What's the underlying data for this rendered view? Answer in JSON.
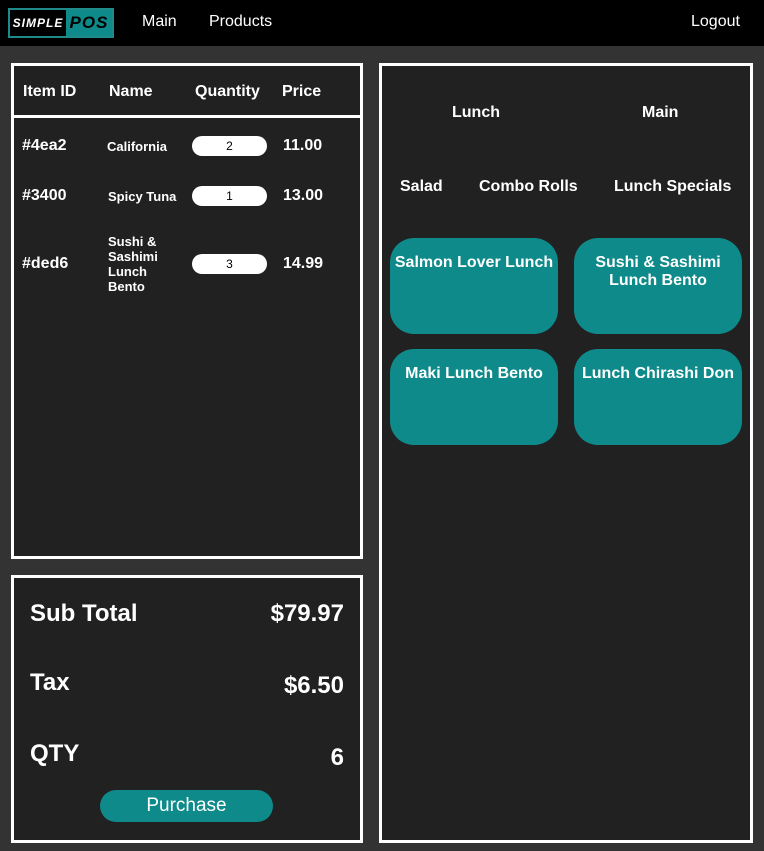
{
  "nav": {
    "logo_left": "SIMPLE",
    "logo_right": "POS",
    "main": "Main",
    "products": "Products",
    "logout": "Logout"
  },
  "cart": {
    "headers": [
      "Item ID",
      "Name",
      "Quantity",
      "Price"
    ],
    "rows": [
      {
        "id": "#4ea2",
        "name": "California",
        "qty": "2",
        "price": "11.00"
      },
      {
        "id": "#3400",
        "name": "Spicy Tuna",
        "qty": "1",
        "price": "13.00"
      },
      {
        "id": "#ded6",
        "name": "Sushi & Sashimi Lunch Bento",
        "qty": "3",
        "price": "14.99"
      }
    ]
  },
  "totals": {
    "subtotal_label": "Sub Total",
    "subtotal_value": "$79.97",
    "tax_label": "Tax",
    "tax_value": "$6.50",
    "qty_label": "QTY",
    "qty_value": "6",
    "purchase_label": "Purchase"
  },
  "menu": {
    "categories": [
      "Lunch",
      "Main",
      "Salad",
      "Combo Rolls",
      "Lunch Specials"
    ],
    "items": [
      "Salmon Lover Lunch",
      "Sushi & Sashimi Lunch Bento",
      "Maki Lunch Bento",
      "Lunch Chirashi Don"
    ]
  },
  "colors": {
    "accent": "#0e8a8a",
    "navbar": "#000000",
    "panel": "#212121",
    "background": "#333333"
  }
}
